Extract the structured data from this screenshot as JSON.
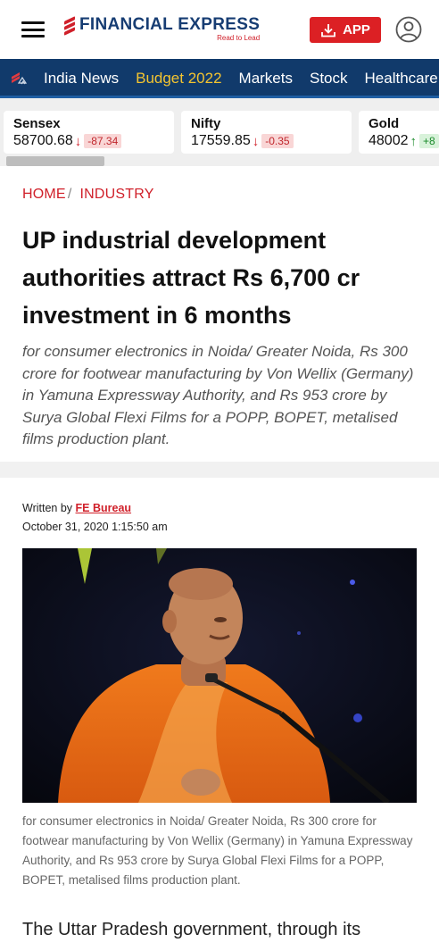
{
  "header": {
    "logo_text": "FINANCIAL EXPRESS",
    "logo_tagline": "Read to Lead",
    "app_button_label": "APP",
    "brand_color": "#dc2024",
    "logo_color": "#173d73"
  },
  "nav": {
    "home_icon": "fe-logo-icon",
    "items": [
      {
        "label": "India News",
        "highlight": false
      },
      {
        "label": "Budget 2022",
        "highlight": true
      },
      {
        "label": "Markets",
        "highlight": false
      },
      {
        "label": "Stock",
        "highlight": false
      },
      {
        "label": "Healthcare",
        "highlight": false
      }
    ],
    "background": "#113a6b"
  },
  "ticker": [
    {
      "name": "Sensex",
      "value": "58700.68",
      "direction": "down",
      "change": "-87.34"
    },
    {
      "name": "Nifty",
      "value": "17559.85",
      "direction": "down",
      "change": "-0.35"
    },
    {
      "name": "Gold",
      "value": "48002",
      "direction": "up",
      "change": "+8"
    }
  ],
  "breadcrumb": {
    "home": "HOME",
    "section": "INDUSTRY"
  },
  "article": {
    "headline": "UP industrial development authorities attract Rs 6,700 cr investment in 6 months",
    "synopsis": "for consumer electronics in Noida/ Greater Noida, Rs 300 crore for footwear manufacturing by Von Wellix (Germany) in Yamuna Expressway Authority, and Rs 953 crore by Surya Global Flexi Films for a POPP, BOPET, metalised films production plant.",
    "byline_prefix": "Written by",
    "author": "FE Bureau",
    "date": "October 31, 2020 1:15:50 am",
    "image_caption": "for consumer electronics in Noida/ Greater Noida, Rs 300 crore for footwear manufacturing by Von Wellix (Germany) in Yamuna Expressway Authority, and Rs 953 crore by Surya Global Flexi Films for a POPP, BOPET, metalised films production plant.",
    "body_first_line": "The Uttar Pradesh government, through its"
  }
}
